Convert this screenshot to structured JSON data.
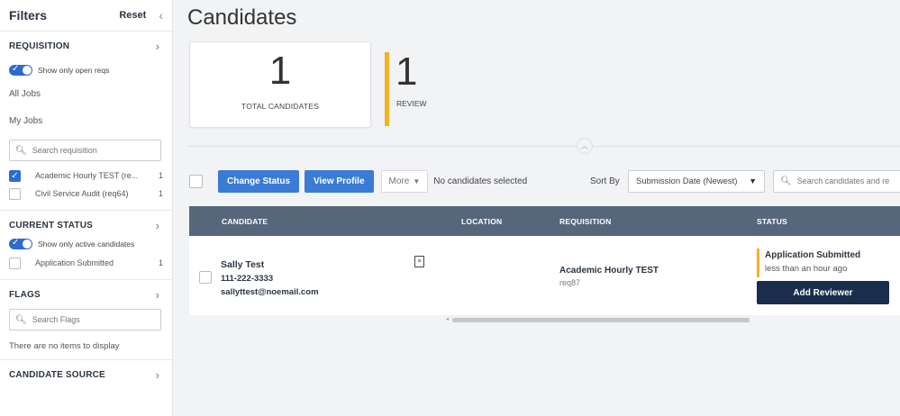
{
  "sidebar": {
    "title": "Filters",
    "reset_label": "Reset",
    "collapse_glyph": "‹",
    "requisition": {
      "label": "REQUISITION",
      "toggle_label": "Show only open reqs",
      "links": [
        "All Jobs",
        "My Jobs"
      ],
      "search_placeholder": "Search requisition",
      "items": [
        {
          "label": "Academic Hourly TEST (re...",
          "count": "1",
          "checked": true
        },
        {
          "label": "Civil Service Audit (req64)",
          "count": "1",
          "checked": false
        }
      ]
    },
    "current_status": {
      "label": "CURRENT STATUS",
      "toggle_label": "Show only active candidates",
      "items": [
        {
          "label": "Application Submitted",
          "count": "1",
          "checked": false
        }
      ]
    },
    "flags": {
      "label": "FLAGS",
      "search_placeholder": "Search Flags",
      "empty_text": "There are no items to display"
    },
    "candidate_source": {
      "label": "CANDIDATE SOURCE"
    }
  },
  "main": {
    "title": "Candidates",
    "stats": [
      {
        "value": "1",
        "label": "TOTAL CANDIDATES"
      },
      {
        "value": "1",
        "label": "REVIEW"
      }
    ],
    "toolbar": {
      "change_status": "Change Status",
      "view_profile": "View Profile",
      "more": "More",
      "selection_status": "No candidates selected",
      "sort_by_label": "Sort By",
      "sort_value": "Submission Date (Newest)",
      "search_placeholder": "Search candidates and re"
    },
    "table": {
      "headers": [
        "CANDIDATE",
        "LOCATION",
        "REQUISITION",
        "STATUS"
      ],
      "rows": [
        {
          "name": "Sally Test",
          "phone": "111-222-3333",
          "email": "sallyttest@noemail.com",
          "requisition": "Academic Hourly TEST",
          "req_id": "req87",
          "status": "Application Submitted",
          "status_time": "less than an hour ago",
          "action": "Add Reviewer"
        }
      ]
    }
  },
  "colors": {
    "primary_button": "#3a7bd5",
    "table_header": "#56677b",
    "accent_bar": "#f0b323",
    "dark_button": "#1a2d4d"
  },
  "icons": [
    "search-icon",
    "chevron-right-icon",
    "chevron-left-icon",
    "caret-down-icon",
    "document-icon",
    "check-icon"
  ]
}
